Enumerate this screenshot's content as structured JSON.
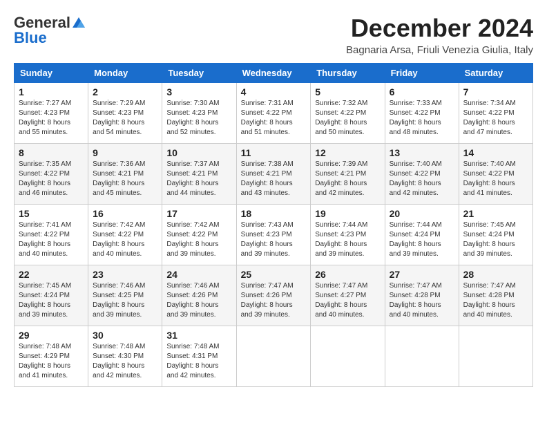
{
  "header": {
    "logo_general": "General",
    "logo_blue": "Blue",
    "month_title": "December 2024",
    "location": "Bagnaria Arsa, Friuli Venezia Giulia, Italy"
  },
  "columns": [
    "Sunday",
    "Monday",
    "Tuesday",
    "Wednesday",
    "Thursday",
    "Friday",
    "Saturday"
  ],
  "weeks": [
    [
      {
        "day": "1",
        "info": "Sunrise: 7:27 AM\nSunset: 4:23 PM\nDaylight: 8 hours\nand 55 minutes."
      },
      {
        "day": "2",
        "info": "Sunrise: 7:29 AM\nSunset: 4:23 PM\nDaylight: 8 hours\nand 54 minutes."
      },
      {
        "day": "3",
        "info": "Sunrise: 7:30 AM\nSunset: 4:23 PM\nDaylight: 8 hours\nand 52 minutes."
      },
      {
        "day": "4",
        "info": "Sunrise: 7:31 AM\nSunset: 4:22 PM\nDaylight: 8 hours\nand 51 minutes."
      },
      {
        "day": "5",
        "info": "Sunrise: 7:32 AM\nSunset: 4:22 PM\nDaylight: 8 hours\nand 50 minutes."
      },
      {
        "day": "6",
        "info": "Sunrise: 7:33 AM\nSunset: 4:22 PM\nDaylight: 8 hours\nand 48 minutes."
      },
      {
        "day": "7",
        "info": "Sunrise: 7:34 AM\nSunset: 4:22 PM\nDaylight: 8 hours\nand 47 minutes."
      }
    ],
    [
      {
        "day": "8",
        "info": "Sunrise: 7:35 AM\nSunset: 4:22 PM\nDaylight: 8 hours\nand 46 minutes."
      },
      {
        "day": "9",
        "info": "Sunrise: 7:36 AM\nSunset: 4:21 PM\nDaylight: 8 hours\nand 45 minutes."
      },
      {
        "day": "10",
        "info": "Sunrise: 7:37 AM\nSunset: 4:21 PM\nDaylight: 8 hours\nand 44 minutes."
      },
      {
        "day": "11",
        "info": "Sunrise: 7:38 AM\nSunset: 4:21 PM\nDaylight: 8 hours\nand 43 minutes."
      },
      {
        "day": "12",
        "info": "Sunrise: 7:39 AM\nSunset: 4:21 PM\nDaylight: 8 hours\nand 42 minutes."
      },
      {
        "day": "13",
        "info": "Sunrise: 7:40 AM\nSunset: 4:22 PM\nDaylight: 8 hours\nand 42 minutes."
      },
      {
        "day": "14",
        "info": "Sunrise: 7:40 AM\nSunset: 4:22 PM\nDaylight: 8 hours\nand 41 minutes."
      }
    ],
    [
      {
        "day": "15",
        "info": "Sunrise: 7:41 AM\nSunset: 4:22 PM\nDaylight: 8 hours\nand 40 minutes."
      },
      {
        "day": "16",
        "info": "Sunrise: 7:42 AM\nSunset: 4:22 PM\nDaylight: 8 hours\nand 40 minutes."
      },
      {
        "day": "17",
        "info": "Sunrise: 7:42 AM\nSunset: 4:22 PM\nDaylight: 8 hours\nand 39 minutes."
      },
      {
        "day": "18",
        "info": "Sunrise: 7:43 AM\nSunset: 4:23 PM\nDaylight: 8 hours\nand 39 minutes."
      },
      {
        "day": "19",
        "info": "Sunrise: 7:44 AM\nSunset: 4:23 PM\nDaylight: 8 hours\nand 39 minutes."
      },
      {
        "day": "20",
        "info": "Sunrise: 7:44 AM\nSunset: 4:24 PM\nDaylight: 8 hours\nand 39 minutes."
      },
      {
        "day": "21",
        "info": "Sunrise: 7:45 AM\nSunset: 4:24 PM\nDaylight: 8 hours\nand 39 minutes."
      }
    ],
    [
      {
        "day": "22",
        "info": "Sunrise: 7:45 AM\nSunset: 4:24 PM\nDaylight: 8 hours\nand 39 minutes."
      },
      {
        "day": "23",
        "info": "Sunrise: 7:46 AM\nSunset: 4:25 PM\nDaylight: 8 hours\nand 39 minutes."
      },
      {
        "day": "24",
        "info": "Sunrise: 7:46 AM\nSunset: 4:26 PM\nDaylight: 8 hours\nand 39 minutes."
      },
      {
        "day": "25",
        "info": "Sunrise: 7:47 AM\nSunset: 4:26 PM\nDaylight: 8 hours\nand 39 minutes."
      },
      {
        "day": "26",
        "info": "Sunrise: 7:47 AM\nSunset: 4:27 PM\nDaylight: 8 hours\nand 40 minutes."
      },
      {
        "day": "27",
        "info": "Sunrise: 7:47 AM\nSunset: 4:28 PM\nDaylight: 8 hours\nand 40 minutes."
      },
      {
        "day": "28",
        "info": "Sunrise: 7:47 AM\nSunset: 4:28 PM\nDaylight: 8 hours\nand 40 minutes."
      }
    ],
    [
      {
        "day": "29",
        "info": "Sunrise: 7:48 AM\nSunset: 4:29 PM\nDaylight: 8 hours\nand 41 minutes."
      },
      {
        "day": "30",
        "info": "Sunrise: 7:48 AM\nSunset: 4:30 PM\nDaylight: 8 hours\nand 42 minutes."
      },
      {
        "day": "31",
        "info": "Sunrise: 7:48 AM\nSunset: 4:31 PM\nDaylight: 8 hours\nand 42 minutes."
      },
      null,
      null,
      null,
      null
    ]
  ]
}
